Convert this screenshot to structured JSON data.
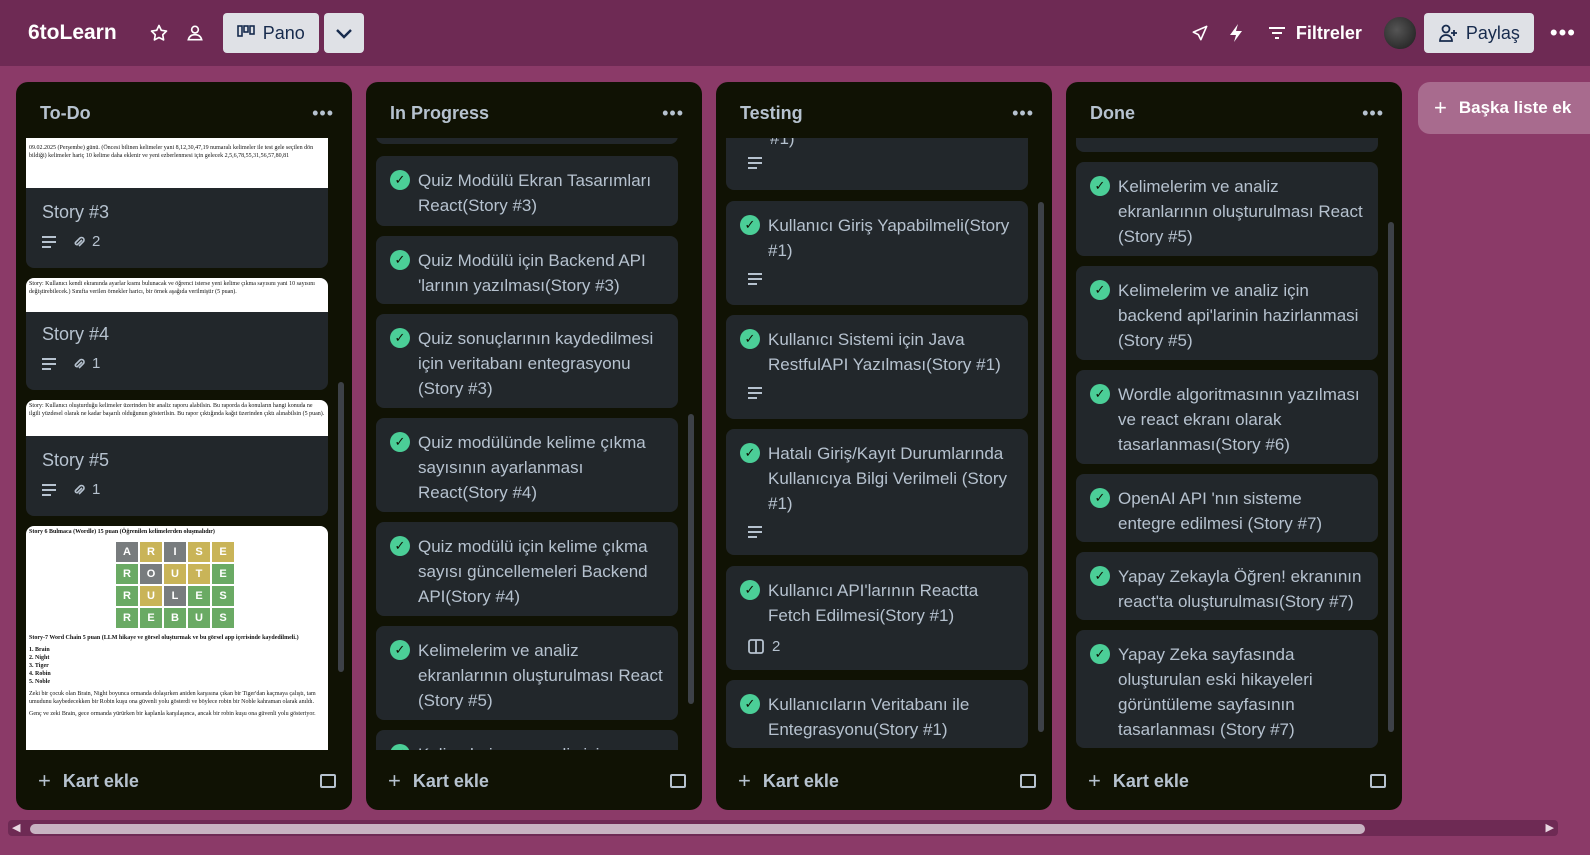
{
  "header": {
    "board_name": "6toLearn",
    "view_label": "Pano",
    "filter_label": "Filtreler",
    "share_label": "Paylaş",
    "icons": [
      "star-icon",
      "workspace-visibility-icon",
      "board-view-icon",
      "chevron-down-icon",
      "rocket-icon",
      "automation-bolt-icon",
      "filter-icon",
      "avatar",
      "add-person-icon",
      "more-icon"
    ]
  },
  "lists": [
    {
      "title": "To-Do",
      "cards": [
        {
          "cover_text": "09.02.2025 (Perşembe) günü. (Öncesi bilinen kelimeler yani 8,12,30,47,19 numaralı kelimeler ile test gele seçilen dön bildiği) kelimeler hariç 10 kelime daha eklenir ve yeni ezberlenmesi için gelecek 2,5,6,78,55,31,56,57,80,81",
          "title": "Story #3",
          "attachments": "2"
        },
        {
          "cover_text": "Story: Kullanıcı kendi ekranında ayarlar kısmı bulunacak ve öğrenci isterse yeni kelime çıkma sayısını yani 10 sayısını değiştirebilecek.) Sınıfta verilen örnekler haricı, bir örnek aşağıda verilmiştir (5 puan).",
          "title": "Story #4",
          "attachments": "1"
        },
        {
          "cover_text": "Story: Kullanıcı oluşturduğu kelimeler üzerinden bir analiz raporu alabilsin. Bu raporda da konuların hangi konuda ne ilgili yüzdesel olarak ne kadar başarılı olduğunun gösterilsin. Bu rapor çıktığında kağıt üzerinden çıktı alınabilsin (5 puan).",
          "title": "Story #5",
          "attachments": "1"
        },
        {
          "cover_heading": "Story 6 Bulmaca (Wordle) 15 puan (Öğrenilen kelimelerden oluşmalıdır)",
          "wordle_rows": [
            "ARISE",
            "ROUTE",
            "RULES",
            "REBUS"
          ],
          "cover_heading2": "Story-7 Word Chain 5 puan (LLM hikaye ve görsel oluşturmak ve bu görsel app içerisinde kaydedilmeli.)",
          "word_list": [
            "1. Brain",
            "2. Night",
            "3. Tiger",
            "4. Robin",
            "5. Noble"
          ],
          "cover_paragraph": "Zeki bir çocuk olan Brain, Night boyunca ormanda dolaşırken aniden karşısına çıkan bir Tiger'dan kaçmaya çalıştı, tam umudunu kaybedecekken bir Robin kuşu ona güvenli yolu gösterdi ve böylece robin bir Noble kahraman olarak anıldı.",
          "cover_paragraph2": "Genç ve zeki Brain, gece ormanda yürürken bir kaplanla karşılaşınca, ancak bir robin kuşu ona güvenli yolu gösteriyor."
        }
      ]
    },
    {
      "title": "In Progress",
      "cards": [
        {
          "text": "Quiz Modülü Ekran Tasarımları React(Story #3)"
        },
        {
          "text": "Quiz Modülü için Backend API 'larının yazılması(Story #3)"
        },
        {
          "text": "Quiz sonuçlarının kaydedilmesi için veritabanı entegrasyonu (Story #3)"
        },
        {
          "text": "Quiz modülünde kelime çıkma sayısının ayarlanması React(Story #4)"
        },
        {
          "text": "Quiz modülü için kelime çıkma sayısı güncellemeleri Backend API(Story #4)"
        },
        {
          "text": "Kelimelerim ve analiz ekranlarının oluşturulması React (Story #5)"
        },
        {
          "text": "Kelimelerim ve analiz için"
        }
      ]
    },
    {
      "title": "Testing",
      "partial_top": "#1)",
      "cards": [
        {
          "text": "Kullanıcı Giriş Yapabilmeli(Story #1)"
        },
        {
          "text": "Kullanıcı Sistemi için Java RestfulAPI Yazılması(Story #1)"
        },
        {
          "text": "Hatalı Giriş/Kayıt Durumlarında Kullanıcıya Bilgi Verilmeli (Story #1)"
        },
        {
          "text": "Kullanıcı API'larının Reactta Fetch Edilmesi(Story #1)",
          "checklist": "2"
        },
        {
          "text": "Kullanıcıların Veritabanı ile Entegrasyonu(Story #1)"
        }
      ]
    },
    {
      "title": "Done",
      "cards": [
        {
          "text": "Kelimelerim ve analiz ekranlarının oluşturulması React (Story #5)"
        },
        {
          "text": "Kelimelerim ve analiz için backend api'larinin hazirlanmasi (Story #5)"
        },
        {
          "text": "Wordle algoritmasının yazılması ve react ekranı olarak tasarlanması(Story #6)"
        },
        {
          "text": "OpenAI API 'nın sisteme entegre edilmesi (Story #7)"
        },
        {
          "text": "Yapay Zekayla Öğren! ekranının react'ta oluşturulması(Story #7)"
        },
        {
          "text": "Yapay Zeka sayfasında oluşturulan eski hikayeleri görüntüleme sayfasının tasarlanması (Story #7)"
        }
      ]
    }
  ],
  "add_card_label": "Kart ekle",
  "add_list_label": "Başka liste ek",
  "colors": {
    "background": "#8b3a68",
    "topbar": "#6e2a54",
    "list_bg": "#101204",
    "card_bg": "#22272b",
    "check_green": "#4bce97",
    "wordle_green": "#6aaa64",
    "wordle_yellow": "#c9b458",
    "wordle_gray": "#787c7e"
  }
}
